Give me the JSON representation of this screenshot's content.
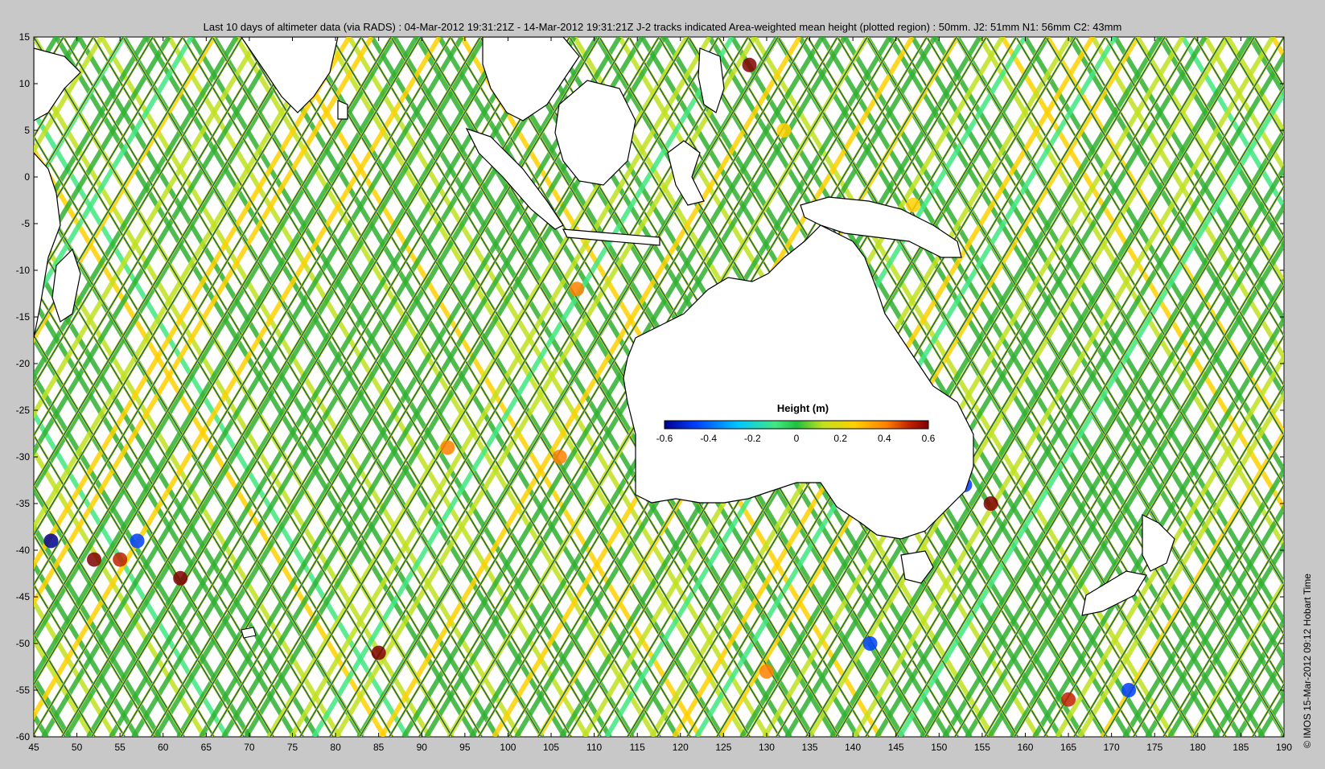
{
  "title": "Last 10 days of altimeter data (via RADS) : 04-Mar-2012 19:31:21Z - 14-Mar-2012 19:31:21Z  J-2 tracks indicated  Area-weighted mean height (plotted region) : 50mm.  J2: 51mm  N1: 56mm  C2: 43mm",
  "credit": "© IMOS 15-Mar-2012 09:12 Hobart Time",
  "map": {
    "lon_range": [
      45,
      190
    ],
    "lat_range": [
      -60,
      15
    ],
    "lon_ticks": [
      "45",
      "50",
      "55",
      "60",
      "65",
      "70",
      "75",
      "80",
      "85",
      "90",
      "95",
      "100",
      "105",
      "110",
      "115",
      "120",
      "125",
      "130",
      "135",
      "140",
      "145",
      "150",
      "155",
      "160",
      "165",
      "170",
      "175",
      "180",
      "185",
      "190"
    ],
    "lat_ticks": [
      "15",
      "10",
      "5",
      "0",
      "-5",
      "-10",
      "-15",
      "-20",
      "-25",
      "-30",
      "-35",
      "-40",
      "-45",
      "-50",
      "-55",
      "-60"
    ]
  },
  "colorbar": {
    "title": "Height (m)",
    "ticks": [
      "-0.6",
      "-0.4",
      "-0.2",
      "0",
      "0.2",
      "0.4",
      "0.6"
    ],
    "range": [
      -0.6,
      0.6
    ],
    "colors": [
      "#00008f",
      "#0040ff",
      "#00c8ff",
      "#40e880",
      "#20c040",
      "#c0e020",
      "#ffd000",
      "#ff8000",
      "#c02000",
      "#800000"
    ]
  },
  "track_colors": {
    "background_pass": "#30b030",
    "j2_line": "#1a6a6a",
    "yellow": "#e8e020"
  }
}
